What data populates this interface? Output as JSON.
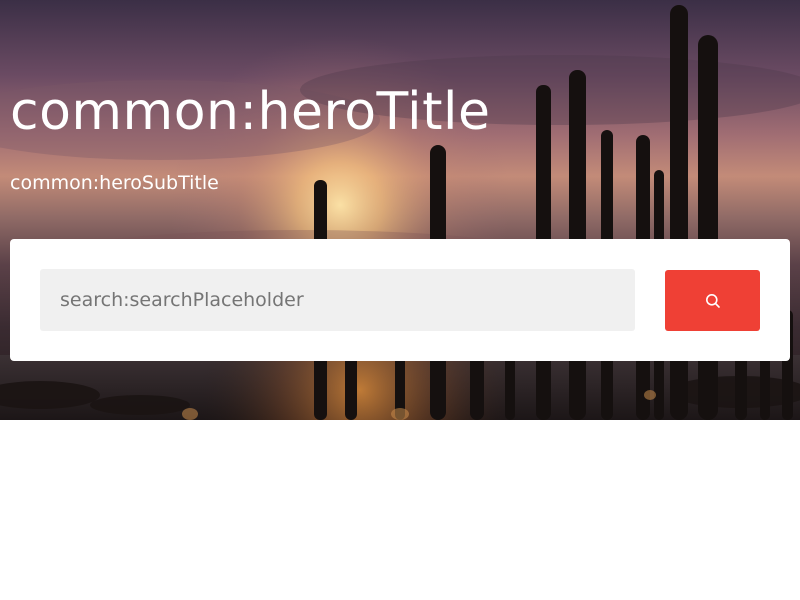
{
  "hero": {
    "title": "common:heroTitle",
    "subtitle": "common:heroSubTitle",
    "background_image": "desert sunset with cacti silhouettes"
  },
  "search": {
    "placeholder": "search:searchPlaceholder",
    "value": "",
    "button_icon": "search-icon",
    "button_color": "#ef4035"
  },
  "colors": {
    "card_background": "#ffffff",
    "input_background": "#f0f0f0",
    "page_background": "#ffffff"
  }
}
